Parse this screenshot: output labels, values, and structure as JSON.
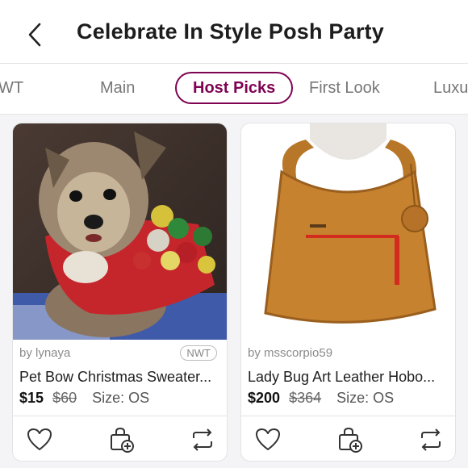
{
  "header": {
    "title": "Celebrate In Style Posh Party",
    "back_icon": "chevron-left-icon"
  },
  "tabs": [
    {
      "label": "WT",
      "active": false
    },
    {
      "label": "Main",
      "active": false
    },
    {
      "label": "Host Picks",
      "active": true
    },
    {
      "label": "First Look",
      "active": false
    },
    {
      "label": "Luxu",
      "active": false
    }
  ],
  "listings": [
    {
      "seller": "by lynaya",
      "condition": "NWT",
      "title": "Pet Bow Christmas Sweater...",
      "price": "$15",
      "original_price": "$60",
      "size": "Size: OS",
      "image": "yorkie-dog-in-red-sweater-with-bows"
    },
    {
      "seller": "by msscorpio59",
      "condition": "",
      "title": "Lady Bug Art Leather Hobo...",
      "price": "$200",
      "original_price": "$364",
      "size": "Size: OS",
      "image": "tan-suede-hobo-bag"
    }
  ],
  "icons": {
    "like": "heart-icon",
    "bundle": "add-to-bundle-icon",
    "share": "share-icon"
  },
  "colors": {
    "accent": "#7f0353",
    "background": "#f4f4f6"
  }
}
